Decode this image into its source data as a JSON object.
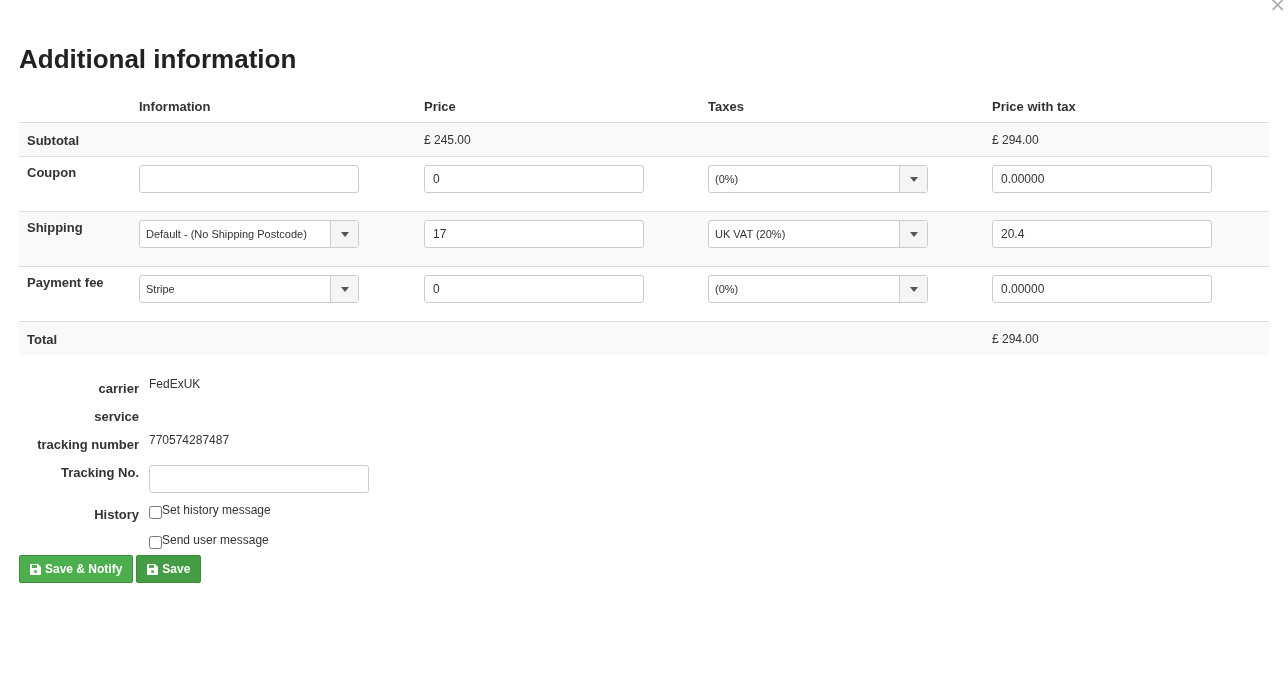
{
  "close": "×",
  "title": "Additional information",
  "table": {
    "columns": [
      "Information",
      "Price",
      "Taxes",
      "Price with tax"
    ],
    "rows": [
      {
        "kind": "summary",
        "label": "Subtotal",
        "price": "£ 245.00",
        "price_with_tax": "£ 294.00"
      },
      {
        "kind": "line",
        "label": "Coupon",
        "information": {
          "kind": "input"
        },
        "price": "0",
        "tax": "(0%)",
        "price_with_tax": "0.00000"
      },
      {
        "kind": "line",
        "label": "Shipping",
        "information": {
          "kind": "select",
          "value": "Default - (No Shipping Postcode)"
        },
        "price": "17",
        "tax": "UK VAT (20%)",
        "price_with_tax": "20.4"
      },
      {
        "kind": "line",
        "label": "Payment fee",
        "information": {
          "kind": "select",
          "value": "Stripe"
        },
        "price": "0",
        "tax": "(0%)",
        "price_with_tax": "0.00000"
      },
      {
        "kind": "summary",
        "label": "Total",
        "price_with_tax": "£ 294.00"
      }
    ]
  },
  "shipment": [
    {
      "kind": "text",
      "label": "carrier",
      "value": "FedExUK"
    },
    {
      "kind": "text",
      "label": "service"
    },
    {
      "kind": "text",
      "label": "tracking number",
      "value": "770574287487"
    },
    {
      "kind": "input",
      "label": "Tracking No."
    }
  ],
  "history": {
    "label": "History",
    "options": [
      {
        "label": "Set history message",
        "checked": false
      },
      {
        "label": "Send user message",
        "checked": false
      }
    ]
  },
  "buttons": [
    "Save & Notify",
    "Save"
  ]
}
